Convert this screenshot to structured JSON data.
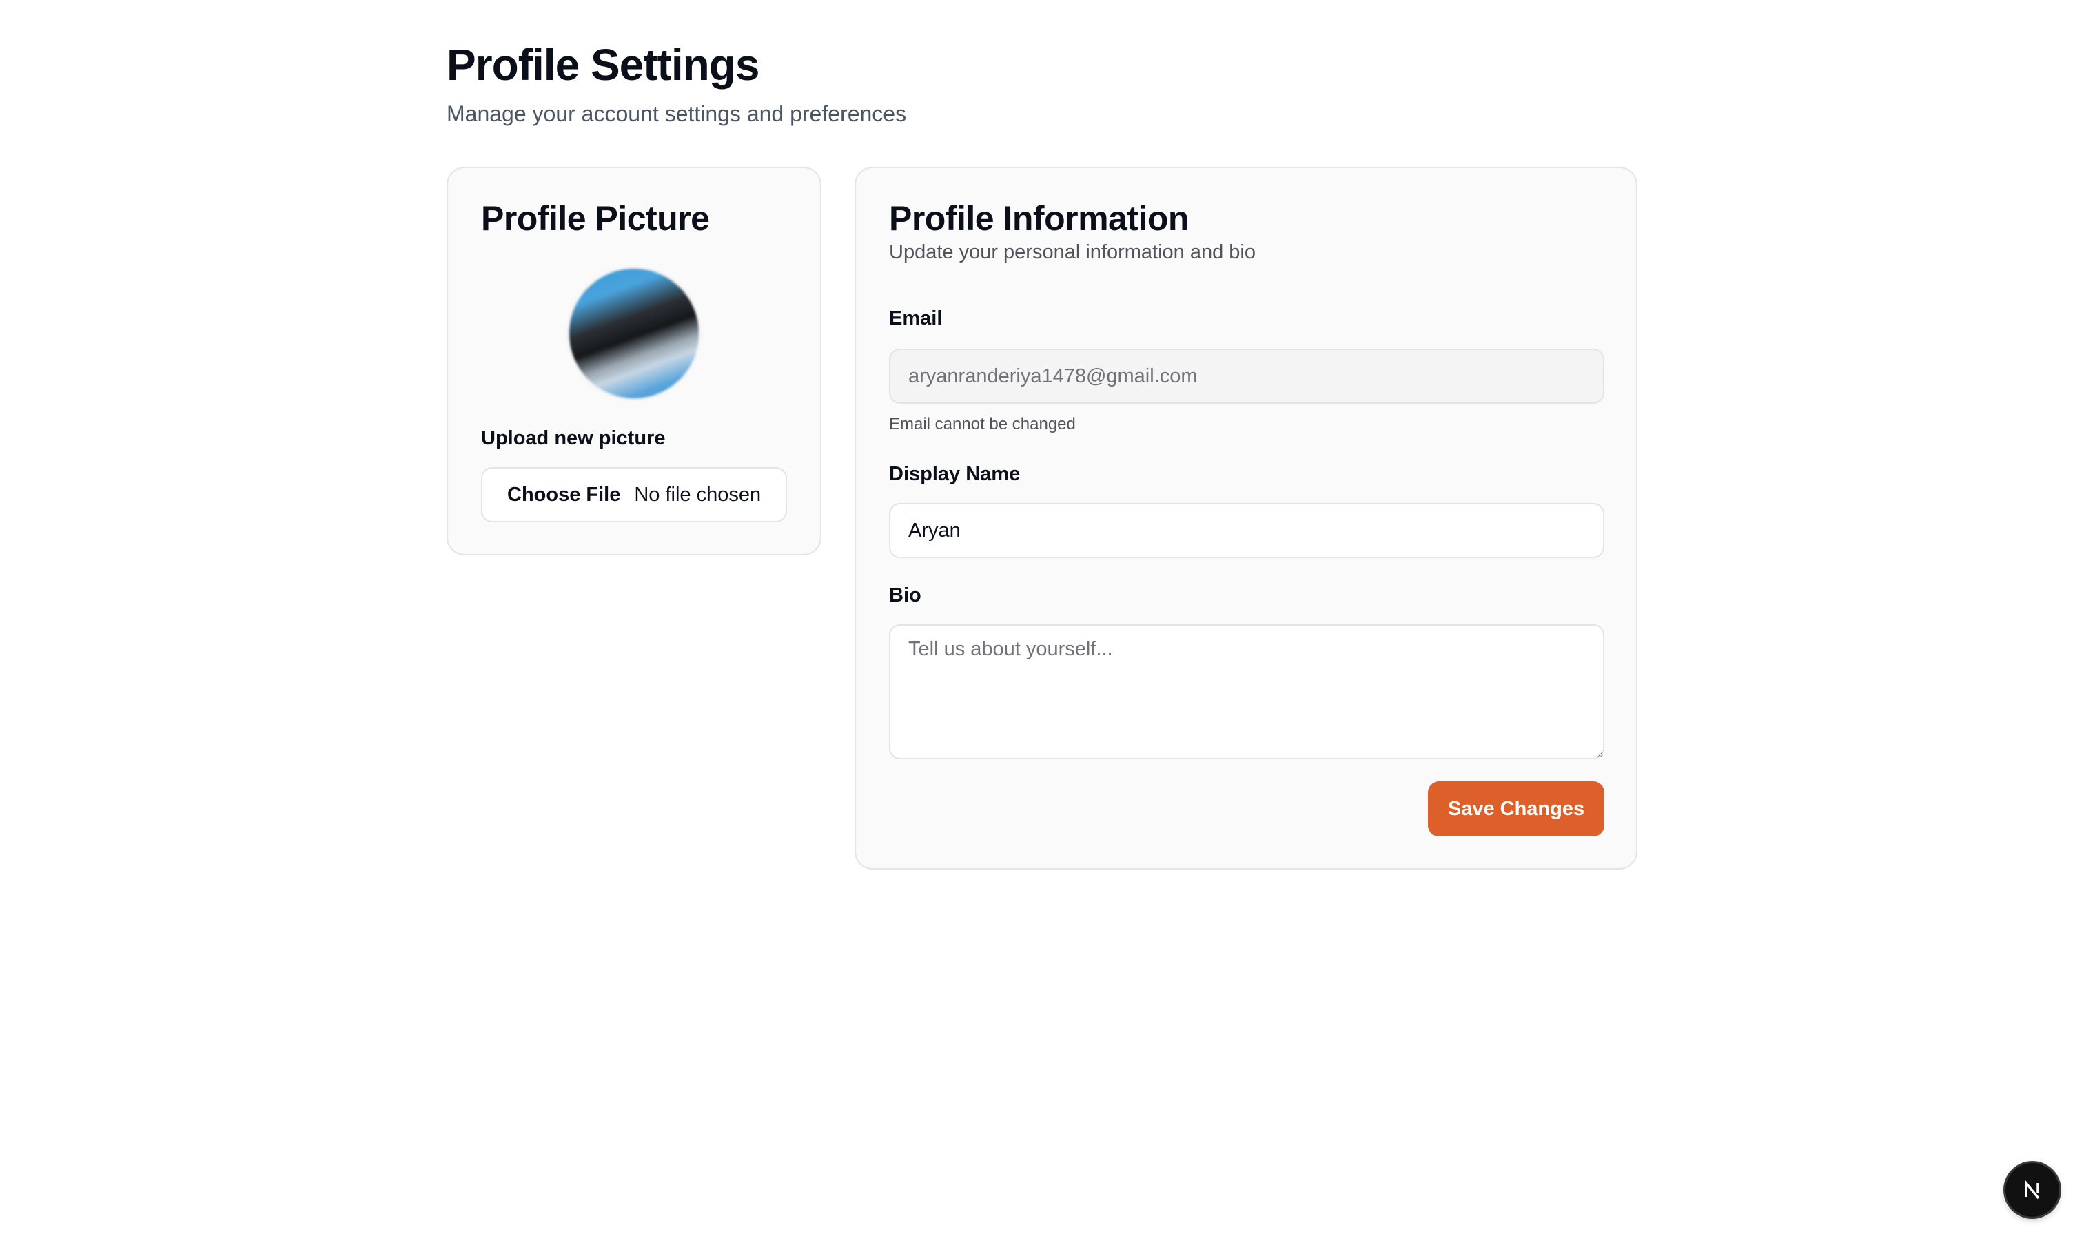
{
  "header": {
    "title": "Profile Settings",
    "subtitle": "Manage your account settings and preferences"
  },
  "picture_card": {
    "title": "Profile Picture",
    "upload_label": "Upload new picture",
    "file_button_label": "Choose File",
    "file_status": "No file chosen"
  },
  "info_card": {
    "title": "Profile Information",
    "description": "Update your personal information and bio",
    "email": {
      "label": "Email",
      "value": "aryanranderiya1478@gmail.com",
      "hint": "Email cannot be changed"
    },
    "display_name": {
      "label": "Display Name",
      "value": "Aryan"
    },
    "bio": {
      "label": "Bio",
      "placeholder": "Tell us about yourself...",
      "value": ""
    },
    "save_label": "Save Changes"
  },
  "dev_badge": {
    "icon": "nextjs-logo-icon"
  },
  "colors": {
    "accent": "#dd5f29",
    "card_background": "#fafafa",
    "border": "#e4e4e7"
  }
}
